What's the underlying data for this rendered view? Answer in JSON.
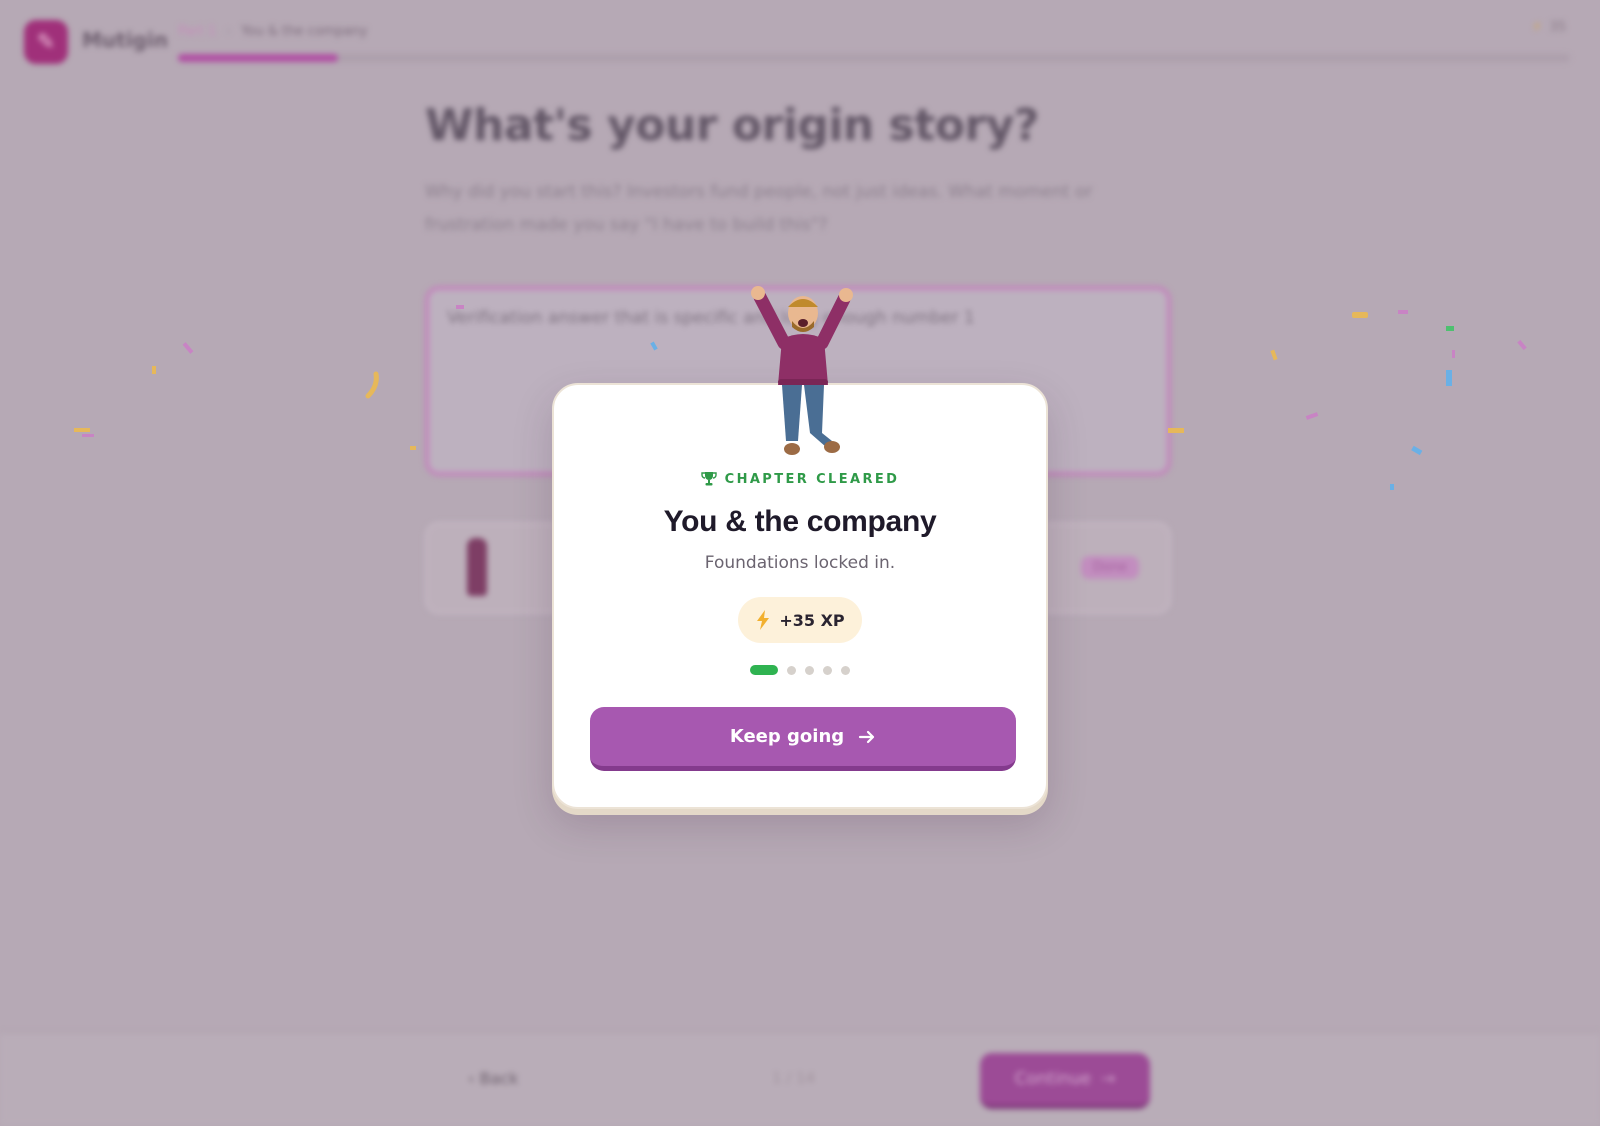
{
  "app": {
    "name": "Mutigin",
    "logo_icon": "feather-icon"
  },
  "breadcrumb": {
    "part1": "Part 1",
    "part2": "You & the company"
  },
  "progress": {
    "fraction": 0.115
  },
  "top_stats": {
    "icon": "bolt-icon",
    "value": "35"
  },
  "page": {
    "heading": "What's your origin story?",
    "subheading": "Why did you start this? Investors fund people, not just ideas. What moment or frustration made you say \"I have to build this\"?",
    "answer_text": "Verification answer that is specific and long enough number 1"
  },
  "preview_card": {
    "badge": "Done"
  },
  "bottom": {
    "back_label": "Back",
    "step_count": "1 / 14",
    "continue_label": "Continue"
  },
  "modal": {
    "eyebrow": "CHAPTER CLEARED",
    "title": "You & the company",
    "subtitle": "Foundations locked in.",
    "xp": "+35 XP",
    "chapters_total": 5,
    "chapters_done": 1,
    "cta_label": "Keep going",
    "colors": {
      "accent": "#a758b0",
      "success": "#2f9a48",
      "xp_bg": "#fdf1da"
    }
  }
}
